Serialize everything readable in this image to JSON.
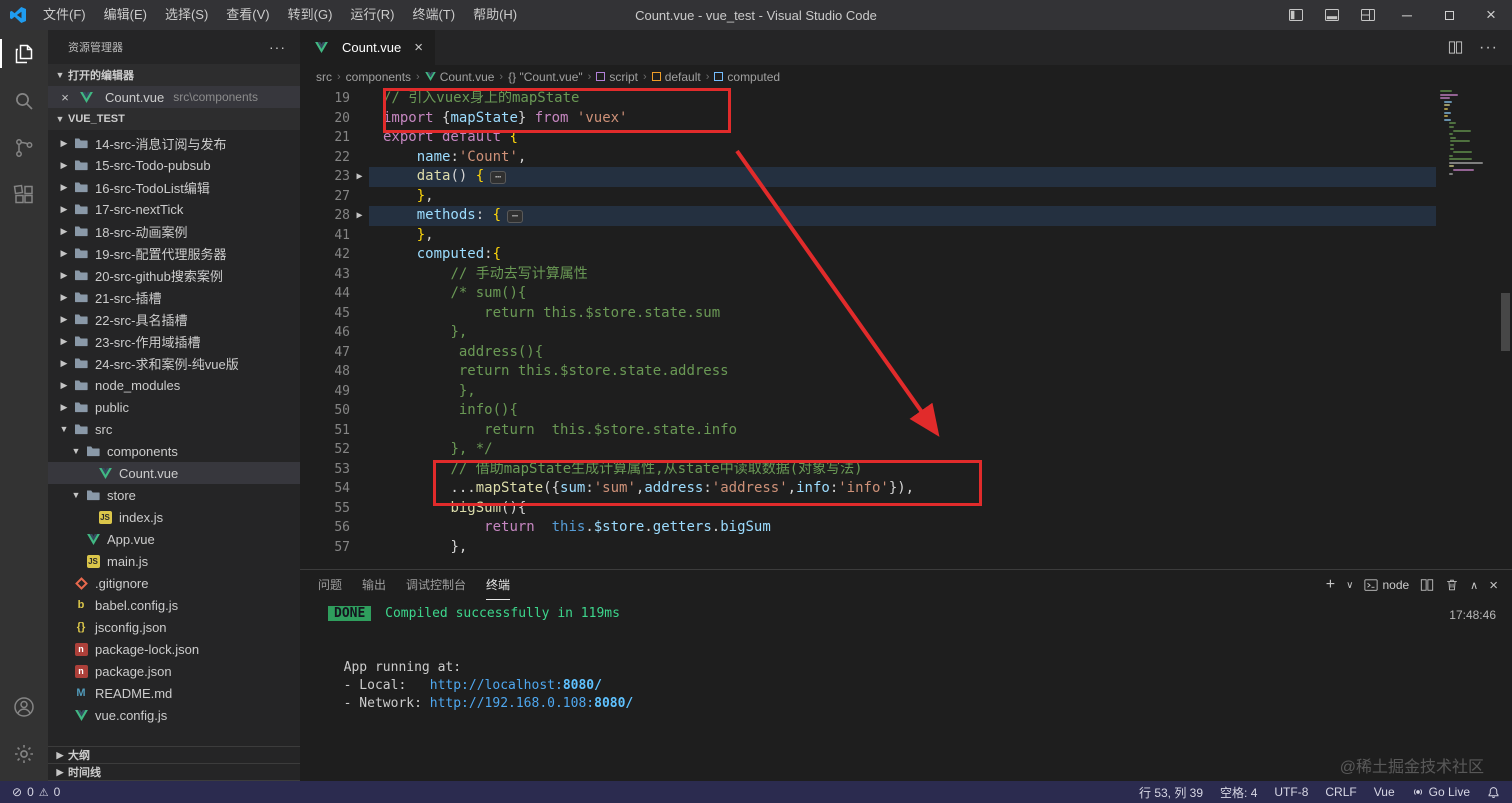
{
  "title_bar": {
    "menus": [
      "文件(F)",
      "编辑(E)",
      "选择(S)",
      "查看(V)",
      "转到(G)",
      "运行(R)",
      "终端(T)",
      "帮助(H)"
    ],
    "title": "Count.vue - vue_test - Visual Studio Code"
  },
  "sidebar": {
    "title": "资源管理器",
    "open_editors_label": "打开的编辑器",
    "open_editor": {
      "file": "Count.vue",
      "path": "src\\components"
    },
    "project": "VUE_TEST",
    "outline_label": "大纲",
    "timeline_label": "时间线",
    "tree": [
      {
        "label": "14-src-消息订阅与发布",
        "icon": "folder",
        "expandable": true,
        "expanded": false,
        "depth": 0
      },
      {
        "label": "15-src-Todo-pubsub",
        "icon": "folder",
        "expandable": true,
        "expanded": false,
        "depth": 0
      },
      {
        "label": "16-src-TodoList编辑",
        "icon": "folder",
        "expandable": true,
        "expanded": false,
        "depth": 0
      },
      {
        "label": "17-src-nextTick",
        "icon": "folder",
        "expandable": true,
        "expanded": false,
        "depth": 0
      },
      {
        "label": "18-src-动画案例",
        "icon": "folder",
        "expandable": true,
        "expanded": false,
        "depth": 0
      },
      {
        "label": "19-src-配置代理服务器",
        "icon": "folder",
        "expandable": true,
        "expanded": false,
        "depth": 0
      },
      {
        "label": "20-src-github搜索案例",
        "icon": "folder",
        "expandable": true,
        "expanded": false,
        "depth": 0
      },
      {
        "label": "21-src-插槽",
        "icon": "folder",
        "expandable": true,
        "expanded": false,
        "depth": 0
      },
      {
        "label": "22-src-具名插槽",
        "icon": "folder",
        "expandable": true,
        "expanded": false,
        "depth": 0
      },
      {
        "label": "23-src-作用域插槽",
        "icon": "folder",
        "expandable": true,
        "expanded": false,
        "depth": 0
      },
      {
        "label": "24-src-求和案例-纯vue版",
        "icon": "folder",
        "expandable": true,
        "expanded": false,
        "depth": 0
      },
      {
        "label": "node_modules",
        "icon": "folder",
        "expandable": true,
        "expanded": false,
        "depth": 0
      },
      {
        "label": "public",
        "icon": "folder",
        "expandable": true,
        "expanded": false,
        "depth": 0
      },
      {
        "label": "src",
        "icon": "folder",
        "expandable": true,
        "expanded": true,
        "depth": 0
      },
      {
        "label": "components",
        "icon": "folder",
        "expandable": true,
        "expanded": true,
        "depth": 1
      },
      {
        "label": "Count.vue",
        "icon": "vue",
        "depth": 2,
        "selected": true
      },
      {
        "label": "store",
        "icon": "folder",
        "expandable": true,
        "expanded": true,
        "depth": 1
      },
      {
        "label": "index.js",
        "icon": "js",
        "depth": 2
      },
      {
        "label": "App.vue",
        "icon": "vue",
        "depth": 1
      },
      {
        "label": "main.js",
        "icon": "js",
        "depth": 1
      },
      {
        "label": ".gitignore",
        "icon": "git",
        "depth": 0
      },
      {
        "label": "babel.config.js",
        "icon": "babel",
        "depth": 0
      },
      {
        "label": "jsconfig.json",
        "icon": "json",
        "depth": 0
      },
      {
        "label": "package-lock.json",
        "icon": "npm",
        "depth": 0
      },
      {
        "label": "package.json",
        "icon": "npm",
        "depth": 0
      },
      {
        "label": "README.md",
        "icon": "md",
        "depth": 0
      },
      {
        "label": "vue.config.js",
        "icon": "vue",
        "depth": 0
      }
    ]
  },
  "editor": {
    "tab": {
      "label": "Count.vue"
    },
    "breadcrumbs": [
      {
        "label": "src"
      },
      {
        "label": "components"
      },
      {
        "label": "Count.vue",
        "icon": "vue"
      },
      {
        "label": "{} \"Count.vue\""
      },
      {
        "label": "script",
        "icon": "module"
      },
      {
        "label": "default",
        "icon": "class"
      },
      {
        "label": "computed",
        "icon": "property"
      }
    ],
    "code": [
      {
        "n": 19,
        "t": [
          [
            "cm",
            "// 引入vuex身上的mapState"
          ]
        ]
      },
      {
        "n": 20,
        "t": [
          [
            "kw",
            "import "
          ],
          [
            "pn",
            "{"
          ],
          [
            "var",
            "mapState"
          ],
          [
            "pn",
            "} "
          ],
          [
            "kw",
            "from"
          ],
          [
            "pn",
            " "
          ],
          [
            "str",
            "'vuex'"
          ]
        ]
      },
      {
        "n": 21,
        "t": [
          [
            "kw",
            "export default "
          ],
          [
            "gold",
            "{"
          ]
        ]
      },
      {
        "n": 22,
        "t": [
          [
            "pn",
            "    "
          ],
          [
            "var",
            "name"
          ],
          [
            "pn",
            ":"
          ],
          [
            "str",
            "'Count'"
          ],
          [
            "pn",
            ","
          ]
        ]
      },
      {
        "n": 23,
        "fold": true,
        "hl": true,
        "t": [
          [
            "pn",
            "    "
          ],
          [
            "fn",
            "data"
          ],
          [
            "pn",
            "() "
          ],
          [
            "gold",
            "{"
          ],
          [
            "dots",
            "⋯"
          ]
        ]
      },
      {
        "n": 27,
        "t": [
          [
            "pn",
            "    "
          ],
          [
            "gold",
            "}"
          ],
          [
            "pn",
            ","
          ]
        ]
      },
      {
        "n": 28,
        "fold": true,
        "hl": true,
        "t": [
          [
            "pn",
            "    "
          ],
          [
            "var",
            "methods"
          ],
          [
            "pn",
            ": "
          ],
          [
            "gold",
            "{"
          ],
          [
            "dots",
            "⋯"
          ]
        ]
      },
      {
        "n": 41,
        "t": [
          [
            "pn",
            "    "
          ],
          [
            "gold",
            "}"
          ],
          [
            "pn",
            ","
          ]
        ]
      },
      {
        "n": 42,
        "t": [
          [
            "pn",
            "    "
          ],
          [
            "var",
            "computed"
          ],
          [
            "pn",
            ":"
          ],
          [
            "gold",
            "{"
          ]
        ]
      },
      {
        "n": 43,
        "t": [
          [
            "pn",
            "        "
          ],
          [
            "cm",
            "// 手动去写计算属性"
          ]
        ]
      },
      {
        "n": 44,
        "t": [
          [
            "pn",
            "        "
          ],
          [
            "cm",
            "/* sum(){"
          ]
        ]
      },
      {
        "n": 45,
        "t": [
          [
            "pn",
            "            "
          ],
          [
            "cm",
            "return this.$store.state.sum"
          ]
        ]
      },
      {
        "n": 46,
        "t": [
          [
            "pn",
            "        "
          ],
          [
            "cm",
            "},"
          ]
        ]
      },
      {
        "n": 47,
        "t": [
          [
            "pn",
            "        "
          ],
          [
            "cm",
            " address(){"
          ]
        ]
      },
      {
        "n": 48,
        "t": [
          [
            "pn",
            "        "
          ],
          [
            "cm",
            " return this.$store.state.address"
          ]
        ]
      },
      {
        "n": 49,
        "t": [
          [
            "pn",
            "        "
          ],
          [
            "cm",
            " },"
          ]
        ]
      },
      {
        "n": 50,
        "t": [
          [
            "pn",
            "        "
          ],
          [
            "cm",
            " info(){"
          ]
        ]
      },
      {
        "n": 51,
        "t": [
          [
            "pn",
            "            "
          ],
          [
            "cm",
            "return  this.$store.state.info"
          ]
        ]
      },
      {
        "n": 52,
        "t": [
          [
            "pn",
            "        "
          ],
          [
            "cm",
            "}, */"
          ]
        ]
      },
      {
        "n": 53,
        "t": [
          [
            "pn",
            "        "
          ],
          [
            "cm",
            "// 借助mapState生成计算属性,从state中读取数据(对象写法)"
          ]
        ]
      },
      {
        "n": 54,
        "t": [
          [
            "pn",
            "        ..."
          ],
          [
            "fn",
            "mapState"
          ],
          [
            "pn",
            "({"
          ],
          [
            "var",
            "sum"
          ],
          [
            "pn",
            ":"
          ],
          [
            "str",
            "'sum'"
          ],
          [
            "pn",
            ","
          ],
          [
            "var",
            "address"
          ],
          [
            "pn",
            ":"
          ],
          [
            "str",
            "'address'"
          ],
          [
            "pn",
            ","
          ],
          [
            "var",
            "info"
          ],
          [
            "pn",
            ":"
          ],
          [
            "str",
            "'info'"
          ],
          [
            "pn",
            "}),"
          ]
        ]
      },
      {
        "n": 55,
        "t": [
          [
            "pn",
            "        "
          ],
          [
            "fn",
            "bigSum"
          ],
          [
            "pn",
            "(){"
          ]
        ]
      },
      {
        "n": 56,
        "t": [
          [
            "pn",
            "            "
          ],
          [
            "kw",
            "return"
          ],
          [
            "pn",
            "  "
          ],
          [
            "kb",
            "this"
          ],
          [
            "pn",
            "."
          ],
          [
            "var",
            "$store"
          ],
          [
            "pn",
            "."
          ],
          [
            "var",
            "getters"
          ],
          [
            "pn",
            "."
          ],
          [
            "var",
            "bigSum"
          ]
        ]
      },
      {
        "n": 57,
        "t": [
          [
            "pn",
            "        "
          ],
          [
            "pn",
            "},"
          ]
        ]
      }
    ]
  },
  "panel": {
    "tabs": [
      {
        "label": "问题",
        "active": false
      },
      {
        "label": "输出",
        "active": false
      },
      {
        "label": "调试控制台",
        "active": false
      },
      {
        "label": "终端",
        "active": true
      }
    ],
    "profile": "node",
    "time": "17:48:46",
    "terminal": [
      {
        "badge": "DONE",
        "segments": [
          [
            "ok",
            " Compiled successfully in 119ms"
          ]
        ]
      },
      {
        "segments": []
      },
      {
        "segments": []
      },
      {
        "segments": [
          [
            "txt",
            "  App running at:"
          ]
        ]
      },
      {
        "segments": [
          [
            "txt",
            "  - Local:   "
          ],
          [
            "url",
            "http://localhost:"
          ],
          [
            "urlb",
            "8080/"
          ]
        ]
      },
      {
        "segments": [
          [
            "txt",
            "  - Network: "
          ],
          [
            "url",
            "http://192.168.0.108:"
          ],
          [
            "urlb",
            "8080/"
          ]
        ]
      }
    ]
  },
  "status_bar": {
    "errors": "0",
    "warnings": "0",
    "items": [
      {
        "label": "行 53, 列 39"
      },
      {
        "label": "空格: 4"
      },
      {
        "label": "UTF-8"
      },
      {
        "label": "CRLF"
      },
      {
        "label": "Vue"
      },
      {
        "label": "Go Live",
        "icon": "broadcast"
      }
    ]
  },
  "watermark": "@稀土掘金技术社区",
  "colors": {
    "accent_red": "#e12b2b",
    "done_green": "#2f9e5d",
    "statusbar": "#2b2b4f"
  }
}
